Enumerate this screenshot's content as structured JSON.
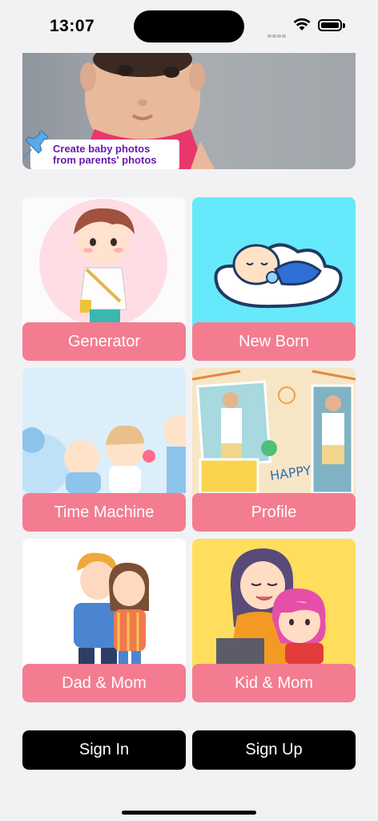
{
  "status_bar": {
    "time": "13:07"
  },
  "banner": {
    "caption_line1": "Create baby photos",
    "caption_line2": "from parents' photos"
  },
  "features": [
    {
      "label": "Generator"
    },
    {
      "label": "New Born"
    },
    {
      "label": "Time Machine"
    },
    {
      "label": "Profile"
    },
    {
      "label": "Dad & Mom"
    },
    {
      "label": "Kid & Mom"
    }
  ],
  "auth": {
    "sign_in": "Sign In",
    "sign_up": "Sign Up"
  },
  "colors": {
    "accent": "#f47c90",
    "button": "#000000",
    "caption": "#6a1ab0"
  }
}
